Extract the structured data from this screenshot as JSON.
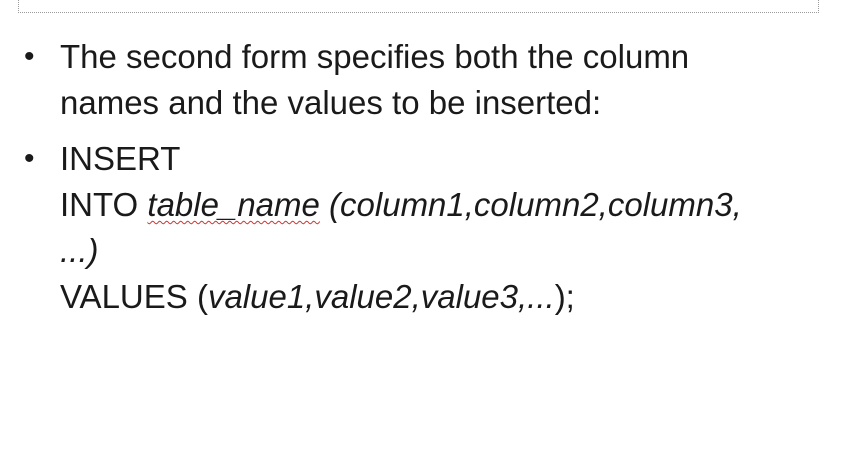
{
  "slide": {
    "bullet_symbol": "•",
    "bullet1": {
      "line1": "The second form specifies both the column",
      "line2": "names and the values to be inserted:"
    },
    "bullet2": {
      "keyword_insert": "INSERT",
      "into_keyword": "INTO ",
      "table_name": "table_name",
      "columns": " (column1,column2,column3,",
      "columns_cont": "...)",
      "values_keyword": "VALUES (",
      "values_list": "value1,value2,value3,...",
      "values_end": ");"
    }
  },
  "colors": {
    "text": "#1a1a1a",
    "spellcheck_underline": "#cc3333",
    "placeholder_border": "#9a9a9a"
  }
}
